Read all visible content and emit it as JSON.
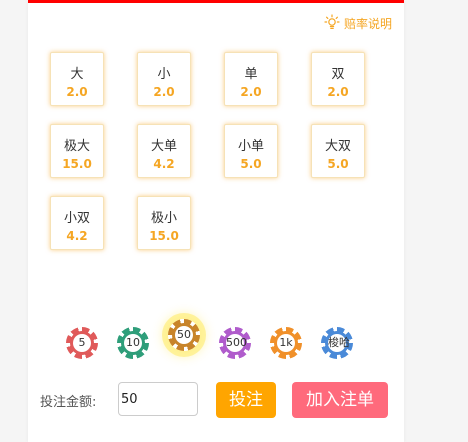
{
  "header": {
    "odds_link_label": "赔率说明",
    "accent_color": "#f5a623",
    "top_bar_color": "#ff0000"
  },
  "bets": [
    {
      "name": "大",
      "odds": "2.0"
    },
    {
      "name": "小",
      "odds": "2.0"
    },
    {
      "name": "单",
      "odds": "2.0"
    },
    {
      "name": "双",
      "odds": "2.0"
    },
    {
      "name": "极大",
      "odds": "15.0"
    },
    {
      "name": "大单",
      "odds": "4.2"
    },
    {
      "name": "小单",
      "odds": "5.0"
    },
    {
      "name": "大双",
      "odds": "5.0"
    },
    {
      "name": "小双",
      "odds": "4.2"
    },
    {
      "name": "极小",
      "odds": "15.0"
    }
  ],
  "chips": [
    {
      "label": "5",
      "color": "#e05a5a",
      "selected": false
    },
    {
      "label": "10",
      "color": "#2f9e7a",
      "selected": false
    },
    {
      "label": "50",
      "color": "#c8842a",
      "selected": true
    },
    {
      "label": "500",
      "color": "#b05ccc",
      "selected": false
    },
    {
      "label": "1k",
      "color": "#f0902a",
      "selected": false
    },
    {
      "label": "梭哈",
      "color": "#4a8ad8",
      "selected": false
    }
  ],
  "form": {
    "amount_label": "投注金额:",
    "amount_value": "50",
    "bet_button": "投注",
    "add_slip_button": "加入注单"
  }
}
